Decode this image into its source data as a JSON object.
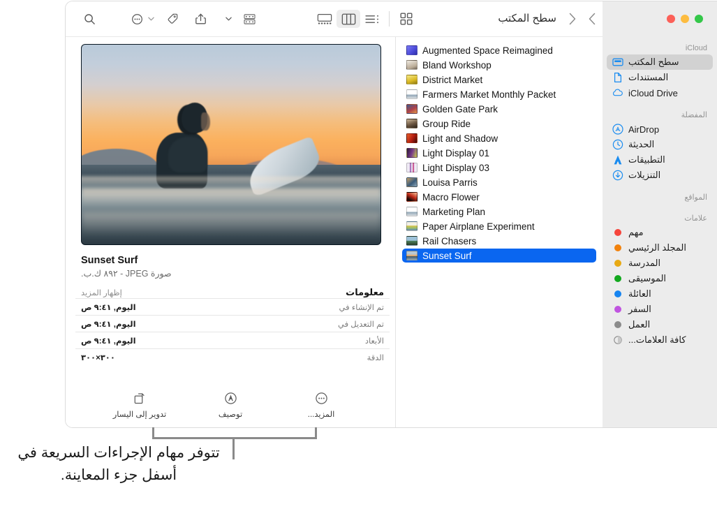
{
  "window": {
    "traffic_lights": [
      "close",
      "minimize",
      "zoom"
    ],
    "title": "سطح المكتب",
    "nav": {
      "back": "‹",
      "forward": "›"
    }
  },
  "toolbar": {
    "items": [
      {
        "name": "search",
        "icon": "search-icon",
        "label": "بحث"
      },
      {
        "name": "group-actions",
        "icon": "more-circle-icon",
        "label": "المزيد"
      },
      {
        "name": "tags",
        "icon": "tag-icon",
        "label": "علامات"
      },
      {
        "name": "share",
        "icon": "share-icon",
        "label": "مشاركة"
      },
      {
        "name": "group-by",
        "icon": "group-icon",
        "label": "تجميع"
      }
    ],
    "view_modes": [
      {
        "name": "icon-view",
        "icon": "gallery-view-icon",
        "active": false
      },
      {
        "name": "column-view",
        "icon": "column-view-icon",
        "active": true
      },
      {
        "name": "list-view",
        "icon": "list-view-icon",
        "active": false
      },
      {
        "name": "grid-view",
        "icon": "grid-view-icon",
        "active": false
      }
    ]
  },
  "sidebar": {
    "sections": [
      {
        "header": "iCloud",
        "items": [
          {
            "label": "سطح المكتب",
            "icon": "desktop-icon",
            "selected": true
          },
          {
            "label": "المستندات",
            "icon": "document-icon",
            "selected": false
          },
          {
            "label": "iCloud Drive",
            "icon": "cloud-icon",
            "selected": false
          }
        ]
      },
      {
        "header": "المفضلة",
        "items": [
          {
            "label": "AirDrop",
            "icon": "airdrop-icon",
            "selected": false
          },
          {
            "label": "الحديثة",
            "icon": "clock-icon",
            "selected": false
          },
          {
            "label": "التطبيقات",
            "icon": "applications-icon",
            "selected": false
          },
          {
            "label": "التنزيلات",
            "icon": "downloads-icon",
            "selected": false
          }
        ]
      },
      {
        "header": "المواقع",
        "items": []
      },
      {
        "header": "علامات",
        "items": [
          {
            "label": "مهم",
            "icon": "tag-dot-icon",
            "color": "#f6453c"
          },
          {
            "label": "المجلد الرئيسي",
            "icon": "tag-dot-icon",
            "color": "#f2820c"
          },
          {
            "label": "المدرسة",
            "icon": "tag-dot-icon",
            "color": "#e8a913"
          },
          {
            "label": "الموسيقى",
            "icon": "tag-dot-icon",
            "color": "#12a81e"
          },
          {
            "label": "العائلة",
            "icon": "tag-dot-icon",
            "color": "#1684f0"
          },
          {
            "label": "السفر",
            "icon": "tag-dot-icon",
            "color": "#c054e0"
          },
          {
            "label": "العمل",
            "icon": "tag-dot-icon",
            "color": "#8b8b8b"
          },
          {
            "label": "كافة العلامات...",
            "icon": "all-tags-icon",
            "color": ""
          }
        ]
      }
    ]
  },
  "file_list": {
    "items": [
      {
        "name": "Augmented Space Reimagined",
        "thumb": "#6d6cf0",
        "selected": false
      },
      {
        "name": "Bland Workshop",
        "thumb": "#c9c3b7",
        "selected": false
      },
      {
        "name": "District Market",
        "thumb": "#e4d34a",
        "selected": false
      },
      {
        "name": "Farmers Market Monthly Packet",
        "thumb": "#f2f2f2",
        "selected": false
      },
      {
        "name": "Golden Gate Park",
        "thumb": "#b05a60",
        "selected": false
      },
      {
        "name": "Group Ride",
        "thumb": "#6b5c4b",
        "selected": false
      },
      {
        "name": "Light and Shadow",
        "thumb": "#c2361a",
        "selected": false
      },
      {
        "name": "Light Display 01",
        "thumb": "#5f3d6b",
        "selected": false
      },
      {
        "name": "Light Display 03",
        "thumb": "#9f7fb5",
        "selected": false
      },
      {
        "name": "Louisa Parris",
        "thumb": "#5a6d84",
        "selected": false
      },
      {
        "name": "Macro Flower",
        "thumb": "#b0281f",
        "selected": false
      },
      {
        "name": "Marketing Plan",
        "thumb": "#f2f2f2",
        "selected": false
      },
      {
        "name": "Paper Airplane Experiment",
        "thumb": "#dfe4cf",
        "selected": false
      },
      {
        "name": "Rail Chasers",
        "thumb": "#6c8ba0",
        "selected": false
      },
      {
        "name": "Sunset Surf",
        "thumb": "#4c6a7e",
        "selected": true
      }
    ]
  },
  "preview": {
    "image_alt": "sunset-surf-photo",
    "file_name": "Sunset Surf",
    "file_meta": "صورة JPEG - ٨٩٢ ك.ب.",
    "section_title": "معلومات",
    "show_more": "إظهار المزيد",
    "info_rows": [
      {
        "key": "تم الإنشاء في",
        "value": "اليوم, ٩:٤١ ص"
      },
      {
        "key": "تم التعديل في",
        "value": "اليوم, ٩:٤١ ص"
      },
      {
        "key": "الأبعاد",
        "value": "اليوم, ٩:٤١ ص"
      },
      {
        "key": "الدقة",
        "value": "٣٠٠×٣٠٠"
      }
    ],
    "quick_actions": [
      {
        "label": "تدوير إلى اليسار",
        "icon": "rotate-left-icon"
      },
      {
        "label": "توصيف",
        "icon": "markup-icon"
      },
      {
        "label": "المزيد...",
        "icon": "more-circle-icon"
      }
    ]
  },
  "callout": {
    "text": "تتوفر مهام الإجراءات السريعة في أسفل جزء المعاينة."
  }
}
